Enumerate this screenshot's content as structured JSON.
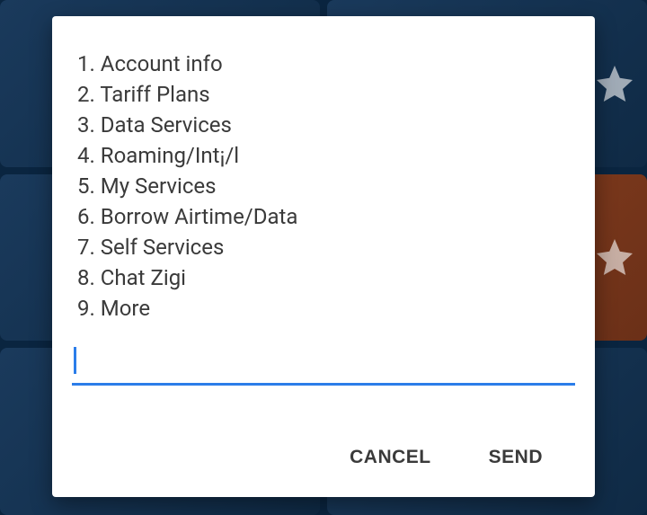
{
  "menu": {
    "items": [
      {
        "number": "1.",
        "label": "Account info"
      },
      {
        "number": "2.",
        "label": "Tariff Plans"
      },
      {
        "number": "3.",
        "label": "Data Services"
      },
      {
        "number": "4.",
        "label": "Roaming/Int¡/l"
      },
      {
        "number": "5.",
        "label": "My Services"
      },
      {
        "number": "6.",
        "label": "Borrow Airtime/Data"
      },
      {
        "number": "7.",
        "label": "Self Services"
      },
      {
        "number": "8.",
        "label": "Chat Zigi"
      },
      {
        "number": "9.",
        "label": "More"
      }
    ]
  },
  "input": {
    "value": ""
  },
  "buttons": {
    "cancel": "CANCEL",
    "send": "SEND"
  }
}
